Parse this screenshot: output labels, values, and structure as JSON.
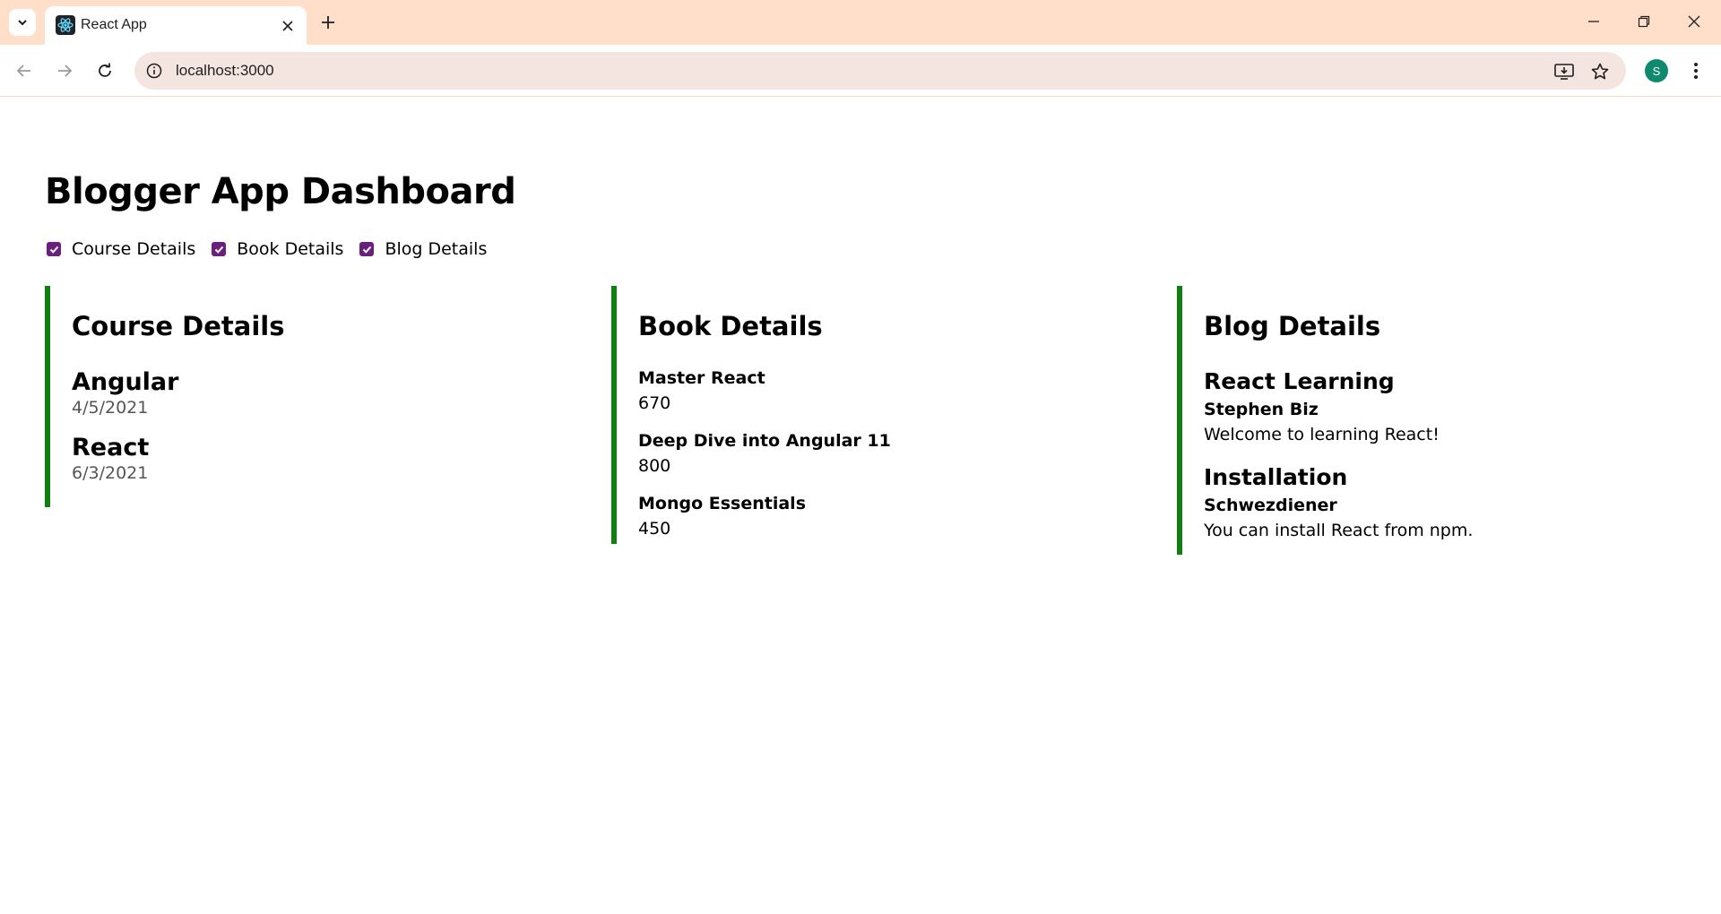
{
  "browser": {
    "tab_title": "React App",
    "url": "localhost:3000",
    "profile_initial": "S"
  },
  "page": {
    "title": "Blogger App Dashboard",
    "filters": [
      {
        "label": "Course Details",
        "checked": true
      },
      {
        "label": "Book Details",
        "checked": true
      },
      {
        "label": "Blog Details",
        "checked": true
      }
    ]
  },
  "courses": {
    "heading": "Course Details",
    "items": [
      {
        "name": "Angular",
        "date": "4/5/2021"
      },
      {
        "name": "React",
        "date": "6/3/2021"
      }
    ]
  },
  "books": {
    "heading": "Book Details",
    "items": [
      {
        "name": "Master React",
        "price": "670"
      },
      {
        "name": "Deep Dive into Angular 11",
        "price": "800"
      },
      {
        "name": "Mongo Essentials",
        "price": "450"
      }
    ]
  },
  "blogs": {
    "heading": "Blog Details",
    "items": [
      {
        "title": "React Learning",
        "author": "Stephen Biz",
        "content": "Welcome to learning React!"
      },
      {
        "title": "Installation",
        "author": "Schwezdiener",
        "content": "You can install React from npm."
      }
    ]
  },
  "colors": {
    "tabstrip": "#ffdfc9",
    "panel_border": "#0f800f",
    "checkbox": "#6b1f7c",
    "avatar": "#0f8a6e"
  }
}
